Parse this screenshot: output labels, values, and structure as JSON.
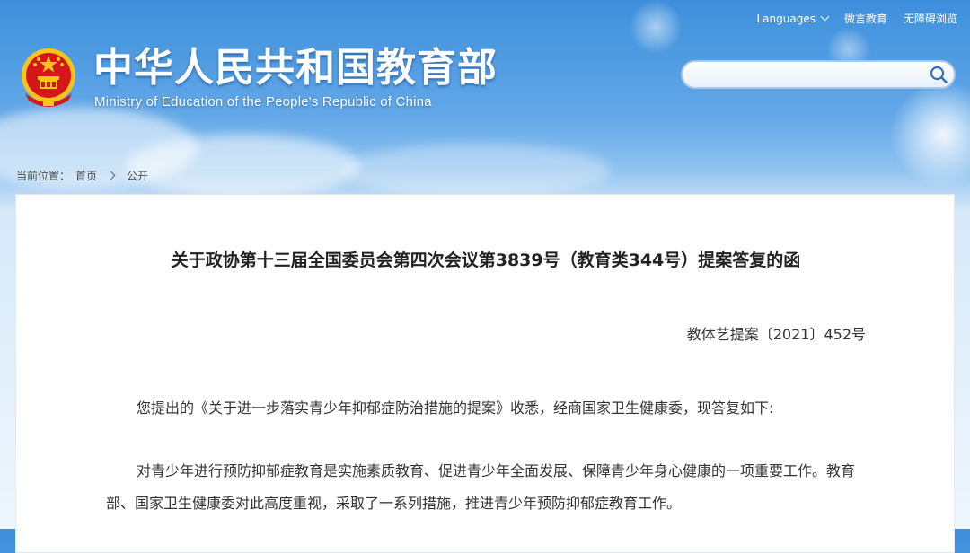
{
  "header": {
    "title": "中华人民共和国教育部",
    "subtitle": "Ministry of Education of the People's Republic of China",
    "emblem_icon": "national-emblem-icon"
  },
  "topnav": {
    "languages": "Languages",
    "weiyan": "微言教育",
    "accessibility": "无障碍浏览"
  },
  "search": {
    "value": "",
    "placeholder": "",
    "icon": "search-icon"
  },
  "breadcrumb": {
    "prefix": "当前位置：",
    "home": "首页",
    "current": "公开"
  },
  "article": {
    "title": "关于政协第十三届全国委员会第四次会议第3839号（教育类344号）提案答复的函",
    "doc_number": "教体艺提案〔2021〕452号",
    "paragraph1": "您提出的《关于进一步落实青少年抑郁症防治措施的提案》收悉，经商国家卫生健康委，现答复如下:",
    "paragraph2": "对青少年进行预防抑郁症教育是实施素质教育、促进青少年全面发展、保障青少年身心健康的一项重要工作。教育部、国家卫生健康委对此高度重视，采取了一系列措施，推进青少年预防抑郁症教育工作。"
  },
  "colors": {
    "sky_top": "#3d8fdc",
    "sky_bottom": "#eef6fd",
    "emblem_red": "#d7161b",
    "emblem_gold": "#f5c518"
  }
}
